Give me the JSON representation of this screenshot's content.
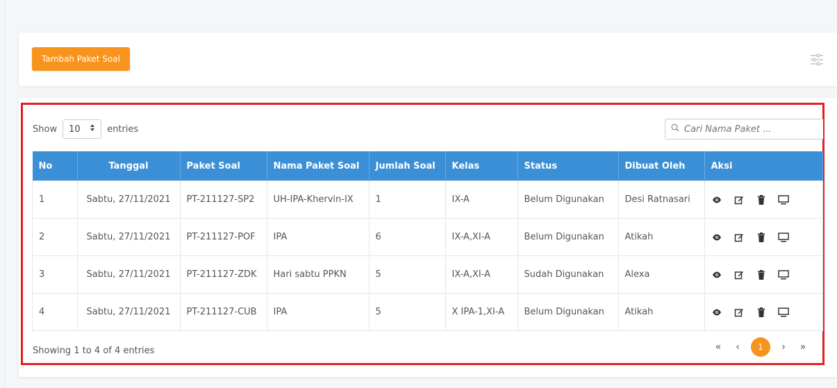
{
  "toolbar": {
    "add_label": "Tambah Paket Soal",
    "filter_icon": "sliders-icon"
  },
  "controls": {
    "show_label": "Show",
    "entries_label": "entries",
    "page_length": "10",
    "search_placeholder": "Cari Nama Paket ..."
  },
  "table": {
    "headers": [
      "No",
      "Tanggal",
      "Paket Soal",
      "Nama Paket Soal",
      "Jumlah Soal",
      "Kelas",
      "Status",
      "Dibuat Oleh",
      "Aksi"
    ],
    "rows": [
      [
        "1",
        "Sabtu, 27/11/2021",
        "PT-211127-SP2",
        "UH-IPA-Khervin-IX",
        "1",
        "IX-A",
        "Belum Digunakan",
        "Desi Ratnasari"
      ],
      [
        "2",
        "Sabtu, 27/11/2021",
        "PT-211127-POF",
        "IPA",
        "6",
        "IX-A,XI-A",
        "Belum Digunakan",
        "Atikah"
      ],
      [
        "3",
        "Sabtu, 27/11/2021",
        "PT-211127-ZDK",
        "Hari sabtu PPKN",
        "5",
        "IX-A,XI-A",
        "Sudah Digunakan",
        "Alexa"
      ],
      [
        "4",
        "Sabtu, 27/11/2021",
        "PT-211127-CUB",
        "IPA",
        "5",
        "X IPA-1,XI-A",
        "Belum Digunakan",
        "Atikah"
      ]
    ],
    "row_actions": [
      "eye-icon",
      "edit-icon",
      "trash-icon",
      "monitor-icon"
    ]
  },
  "footer": {
    "info": "Showing 1 to 4 of 4 entries",
    "pagination": {
      "first": "«",
      "prev": "‹",
      "current": "1",
      "next": "›",
      "last": "»"
    }
  },
  "colors": {
    "accent": "#f7941d",
    "header": "#3a8fd6",
    "highlight": "#e02020"
  }
}
